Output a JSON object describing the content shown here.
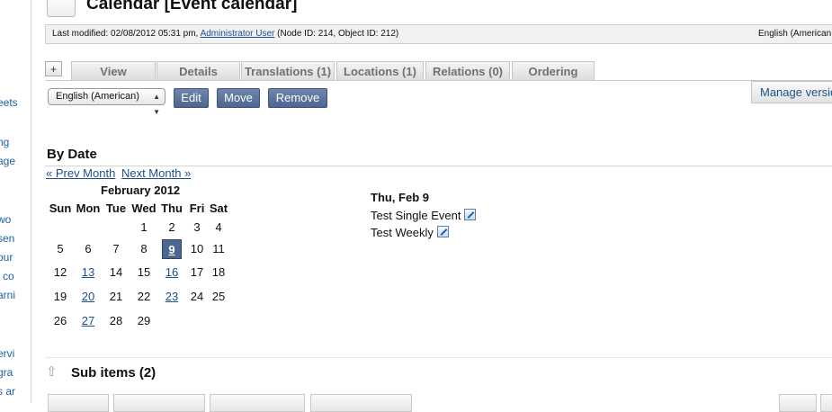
{
  "header": {
    "title": "Calendar [Event calendar]"
  },
  "infobar": {
    "prefix": "Last modified: 02/08/2012 05:31 pm,",
    "author": "Administrator User",
    "ids": "(Node ID: 214, Object ID: 212)",
    "language": "English (American"
  },
  "tabs": {
    "add_symbol": "+",
    "items": [
      {
        "label": "View"
      },
      {
        "label": "Details"
      },
      {
        "label": "Translations (1)"
      },
      {
        "label": "Locations (1)"
      },
      {
        "label": "Relations (0)"
      },
      {
        "label": "Ordering"
      }
    ]
  },
  "actions": {
    "language_select": "English (American)",
    "edit": "Edit",
    "move": "Move",
    "remove": "Remove",
    "manage_versions": "Manage versio"
  },
  "sidebar_fragments": [
    "eets",
    "ng",
    "age",
    "wo",
    "sen",
    "our",
    "l co",
    "arni",
    "ervi",
    "gra",
    "s ar"
  ],
  "by_date": {
    "heading": "By Date",
    "prev": "« Prev Month",
    "next": "Next Month »",
    "month_label": "February 2012",
    "weekdays": [
      "Sun",
      "Mon",
      "Tue",
      "Wed",
      "Thu",
      "Fri",
      "Sat"
    ],
    "weeks": [
      [
        "",
        "",
        "",
        "1",
        "2",
        "3",
        "4"
      ],
      [
        "5",
        "6",
        "7",
        "8",
        "9",
        "10",
        "11"
      ],
      [
        "12",
        "13",
        "14",
        "15",
        "16",
        "17",
        "18"
      ],
      [
        "19",
        "20",
        "21",
        "22",
        "23",
        "24",
        "25"
      ],
      [
        "26",
        "27",
        "28",
        "29",
        "",
        "",
        ""
      ]
    ],
    "linked_days": [
      "9",
      "13",
      "16",
      "20",
      "23",
      "27"
    ],
    "selected_day": "9"
  },
  "events": {
    "day_label": "Thu, Feb 9",
    "items": [
      {
        "title": "Test Single Event"
      },
      {
        "title": "Test Weekly"
      }
    ]
  },
  "sub_items": {
    "title": "Sub items (2)"
  },
  "colors": {
    "button_blue": "#4d6690",
    "link": "#1e4f8c"
  }
}
